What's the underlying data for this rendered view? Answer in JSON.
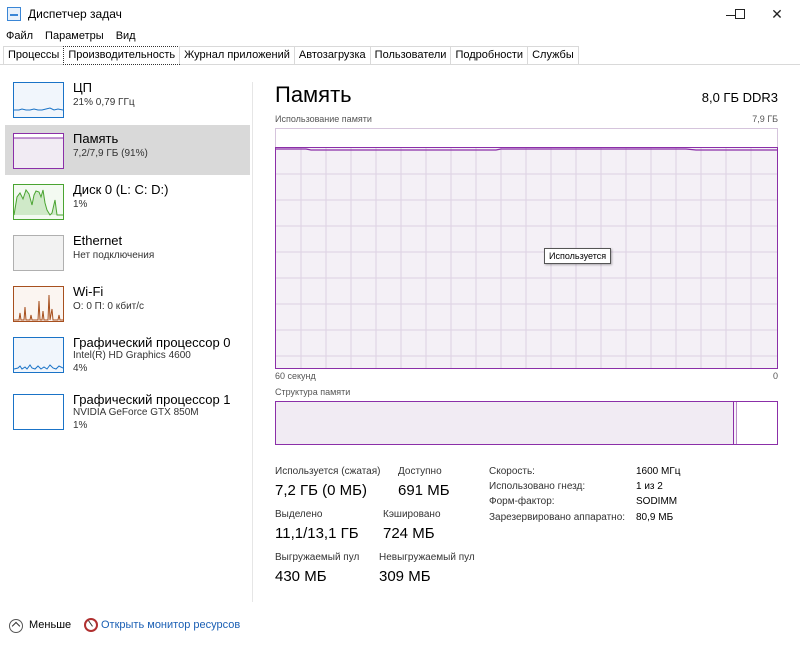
{
  "window": {
    "title": "Диспетчер задач",
    "controls": [
      "minimize-icon",
      "maximize-icon",
      "close-icon"
    ]
  },
  "menu": [
    "Файл",
    "Параметры",
    "Вид"
  ],
  "tabs": [
    {
      "label": "Процессы",
      "active": false
    },
    {
      "label": "Производительность",
      "active": true
    },
    {
      "label": "Журнал приложений",
      "active": false
    },
    {
      "label": "Автозагрузка",
      "active": false
    },
    {
      "label": "Пользователи",
      "active": false
    },
    {
      "label": "Подробности",
      "active": false
    },
    {
      "label": "Службы",
      "active": false
    }
  ],
  "sidebar": {
    "items": [
      {
        "name": "ЦП",
        "sub1": "21% 0,79 ГГц",
        "sub2": "",
        "color": "#1a73c7",
        "active": false
      },
      {
        "name": "Память",
        "sub1": "7,2/7,9 ГБ (91%)",
        "sub2": "",
        "color": "#8b2fa8",
        "active": true
      },
      {
        "name": "Диск 0 (L: C: D:)",
        "sub1": "1%",
        "sub2": "",
        "color": "#4aa431",
        "active": false
      },
      {
        "name": "Ethernet",
        "sub1": "Нет подключения",
        "sub2": "",
        "color": "#999999",
        "active": false
      },
      {
        "name": "Wi-Fi",
        "sub1": "О: 0 П: 0 кбит/с",
        "sub2": "",
        "color": "#a7501f",
        "active": false
      },
      {
        "name": "Графический процессор 0",
        "sub1": "Intel(R) HD Graphics 4600",
        "sub2": "4%",
        "color": "#1a73c7",
        "active": false
      },
      {
        "name": "Графический процессор 1",
        "sub1": "NVIDIA GeForce GTX 850M",
        "sub2": "1%",
        "color": "#1a73c7",
        "active": false
      }
    ]
  },
  "main": {
    "title": "Память",
    "spec": "8,0 ГБ DDR3",
    "usage_label": "Использование памяти",
    "usage_max": "7,9 ГБ",
    "time_left": "60 секунд",
    "time_right": "0",
    "tooltip": "Используется",
    "composition_label": "Структура памяти",
    "usage_fraction": 0.91,
    "stats": {
      "in_use_label": "Используется (сжатая)",
      "in_use_value": "7,2 ГБ (0 МБ)",
      "available_label": "Доступно",
      "available_value": "691 МБ",
      "committed_label": "Выделено",
      "committed_value": "11,1/13,1 ГБ",
      "cached_label": "Кэшировано",
      "cached_value": "724 МБ",
      "paged_label": "Выгружаемый пул",
      "paged_value": "430 МБ",
      "nonpaged_label": "Невыгружаемый пул",
      "nonpaged_value": "309 МБ"
    },
    "details": [
      {
        "label": "Скорость:",
        "value": "1600 МГц"
      },
      {
        "label": "Использовано гнезд:",
        "value": "1 из 2"
      },
      {
        "label": "Форм-фактор:",
        "value": "SODIMM"
      },
      {
        "label": "Зарезервировано аппаратно:",
        "value": "80,9 МБ"
      }
    ]
  },
  "bottom": {
    "less_label": "Меньше",
    "monitor_label": "Открыть монитор ресурсов"
  },
  "colors": {
    "memory_accent": "#8b2fa8",
    "selected_bg": "#d9d9d9",
    "link": "#1a5fb4"
  }
}
